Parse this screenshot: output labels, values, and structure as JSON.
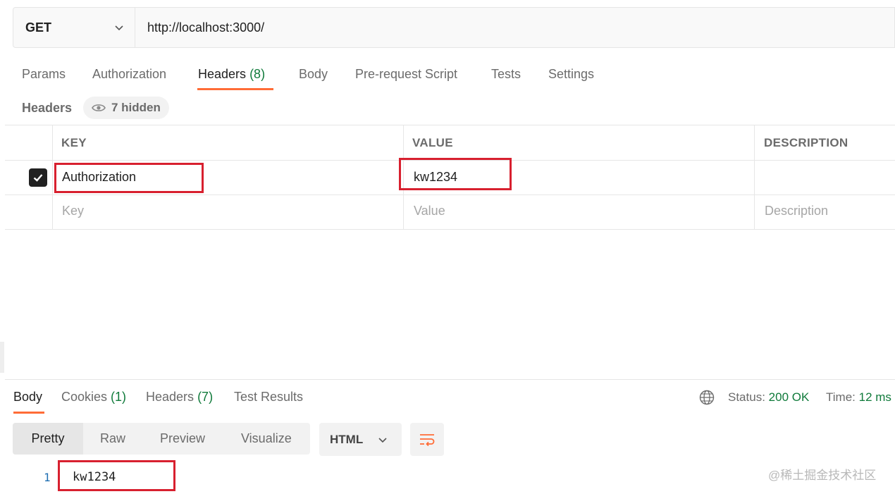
{
  "request": {
    "method": "GET",
    "url": "http://localhost:3000/"
  },
  "request_tabs": {
    "params": "Params",
    "authorization": "Authorization",
    "headers": "Headers",
    "headers_count": "(8)",
    "body": "Body",
    "prerequest": "Pre-request Script",
    "tests": "Tests",
    "settings": "Settings"
  },
  "headers_section": {
    "title": "Headers",
    "hidden_label": "7 hidden"
  },
  "table": {
    "columns": {
      "key": "KEY",
      "value": "VALUE",
      "description": "DESCRIPTION"
    },
    "rows": [
      {
        "key": "Authorization",
        "value": "kw1234",
        "description": "",
        "checked": true
      }
    ],
    "placeholders": {
      "key": "Key",
      "value": "Value",
      "description": "Description"
    }
  },
  "response_tabs": {
    "body": "Body",
    "cookies": "Cookies",
    "cookies_count": "(1)",
    "headers": "Headers",
    "headers_count": "(7)",
    "test_results": "Test Results"
  },
  "response_status": {
    "status_label": "Status:",
    "status_value": "200 OK",
    "time_label": "Time:",
    "time_value": "12 ms"
  },
  "view_modes": {
    "pretty": "Pretty",
    "raw": "Raw",
    "preview": "Preview",
    "visualize": "Visualize"
  },
  "format": {
    "selected": "HTML"
  },
  "response_body": {
    "line_number": "1",
    "content": "kw1234"
  },
  "watermark": "@稀土掘金技术社区",
  "colors": {
    "accent": "#ff6c37",
    "success": "#0f7a3a",
    "highlight_box": "#d8202f"
  }
}
